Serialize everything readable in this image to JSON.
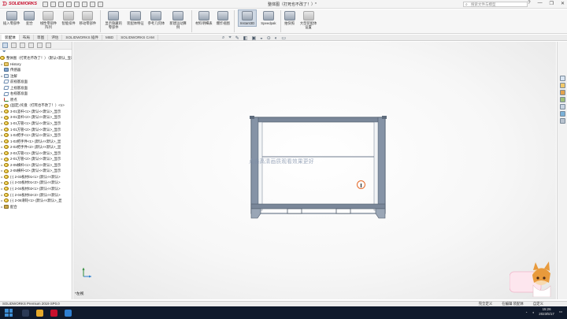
{
  "app": {
    "brand": "SOLIDWORKS",
    "document_title": "整体图（打死也不改了！）*",
    "search_placeholder": "搜索文件与模型",
    "window_controls": [
      "?",
      "—",
      "❐",
      "✕"
    ]
  },
  "ribbon": {
    "buttons": [
      {
        "label": "插入零部件",
        "style": "blue"
      },
      {
        "label": "配合",
        "style": "blue"
      },
      {
        "label": "线性零部件阵列",
        "style": "gray"
      },
      {
        "label": "智能扣件",
        "style": "gray"
      },
      {
        "label": "移动零部件",
        "style": "gray"
      },
      {
        "label": "显示隐藏的零部件",
        "style": "blue"
      },
      {
        "label": "装配体特征",
        "style": "blue"
      },
      {
        "label": "参考几何体",
        "style": "blue"
      },
      {
        "label": "新建运动算例",
        "style": "blue"
      },
      {
        "label": "材料明细表",
        "style": "blue"
      },
      {
        "label": "爆炸视图",
        "style": "blue"
      },
      {
        "label": "Instant3D",
        "style": "active"
      },
      {
        "label": "Speedpak",
        "style": "blue"
      },
      {
        "label": "拍快照",
        "style": "blue"
      },
      {
        "label": "大型装配体设置",
        "style": "gray"
      }
    ]
  },
  "command_tabs": [
    "装配体",
    "布局",
    "草图",
    "评估",
    "SOLIDWORKS 插件",
    "MBD",
    "SOLIDWORKS CAM"
  ],
  "heads_up": [
    "⌕",
    "⌖",
    "✎",
    "◧",
    "▣",
    "◒",
    "⊙",
    "◐",
    "▭"
  ],
  "feature_tree": {
    "filter_icon": "filter-icon",
    "items": [
      {
        "expand": "",
        "icon": "part",
        "text": "整体图（打死也不改了！）（默认<默认_显示状态-1>）"
      },
      {
        "expand": "▸",
        "icon": "folder",
        "text": "History"
      },
      {
        "expand": "",
        "icon": "sensor",
        "text": "传感器"
      },
      {
        "expand": "▸",
        "icon": "note",
        "text": "注解"
      },
      {
        "expand": "",
        "icon": "plane",
        "text": "前视基准面"
      },
      {
        "expand": "",
        "icon": "plane",
        "text": "上视基准面"
      },
      {
        "expand": "",
        "icon": "plane",
        "text": "右视基准面"
      },
      {
        "expand": "",
        "icon": "origin",
        "text": "原点"
      },
      {
        "expand": "▸",
        "icon": "part",
        "text": "(固定) 托盘（打死也不改了！）<1>"
      },
      {
        "expand": "▸",
        "icon": "part",
        "text": "3-01竖杆<1> (默认<<默认>_显示"
      },
      {
        "expand": "▸",
        "icon": "part",
        "text": "3-01竖杆<2> (默认<<默认>_显示"
      },
      {
        "expand": "▸",
        "icon": "part",
        "text": "1-01方管<1> (默认<<默认>_显示"
      },
      {
        "expand": "▸",
        "icon": "part",
        "text": "1-01方管<2> (默认<<默认>_显示"
      },
      {
        "expand": "▸",
        "icon": "part",
        "text": "1-02把手<1> (默认<<默认>_显示"
      },
      {
        "expand": "▸",
        "icon": "part",
        "text": "1-02把手件<1> (默认<<默认>_显"
      },
      {
        "expand": "▸",
        "icon": "part",
        "text": "2-02把手件<2> (默认<<默认>_显"
      },
      {
        "expand": "▸",
        "icon": "part",
        "text": "2-02方管<1> (默认<<默认>_显示"
      },
      {
        "expand": "▸",
        "icon": "part",
        "text": "2-01方管<2> (默认<<默认>_显示"
      },
      {
        "expand": "▸",
        "icon": "part",
        "text": "2-05横杆<1> (默认<<默认>_显示"
      },
      {
        "expand": "▸",
        "icon": "part",
        "text": "2-05横杆<2> (默认<<默认>_显示"
      },
      {
        "expand": "▸",
        "icon": "part",
        "text": "(-) 2-03板材01<1> (默认<<默认>"
      },
      {
        "expand": "▸",
        "icon": "part",
        "text": "(-) 2-03板材01<2> (默认<<默认>"
      },
      {
        "expand": "▸",
        "icon": "part",
        "text": "(-) 2-04板材02<1> (默认<<默认>"
      },
      {
        "expand": "▸",
        "icon": "part",
        "text": "(-) 2-04板材02<2> (默认<<默认>"
      },
      {
        "expand": "▸",
        "icon": "part",
        "text": "(-) 2-06滑轮<1> (默认<<默认>_显"
      },
      {
        "expand": "▸",
        "icon": "mate",
        "text": "配合"
      }
    ]
  },
  "graphics": {
    "watermark": "点击高清画质观看效果更好",
    "view_label": "*左视"
  },
  "status": {
    "left": "SOLIDWORKS Premium 2019 SP0.0",
    "items": [
      "完全定义",
      "在编辑 装配体",
      "自定义"
    ]
  },
  "taskbar": {
    "time": "15:26",
    "date": "2023/5/17"
  },
  "colors": {
    "accent": "#c8102e",
    "frame": "#7a8a9e",
    "taskbar": "#101a2c"
  }
}
